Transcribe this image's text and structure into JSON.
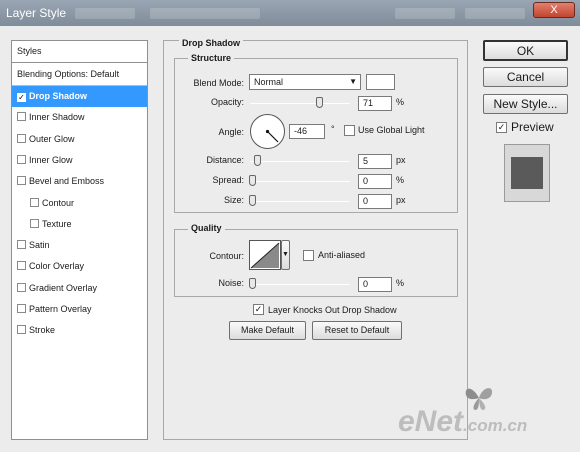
{
  "window": {
    "title": "Layer Style",
    "close_label": "X"
  },
  "styles_panel": {
    "header": "Styles",
    "blending_options": "Blending Options: Default",
    "items": [
      {
        "label": "Drop Shadow",
        "checked": true,
        "selected": true
      },
      {
        "label": "Inner Shadow",
        "checked": false
      },
      {
        "label": "Outer Glow",
        "checked": false
      },
      {
        "label": "Inner Glow",
        "checked": false
      },
      {
        "label": "Bevel and Emboss",
        "checked": false
      },
      {
        "label": "Contour",
        "checked": false,
        "indented": true
      },
      {
        "label": "Texture",
        "checked": false,
        "indented": true
      },
      {
        "label": "Satin",
        "checked": false
      },
      {
        "label": "Color Overlay",
        "checked": false
      },
      {
        "label": "Gradient Overlay",
        "checked": false
      },
      {
        "label": "Pattern Overlay",
        "checked": false
      },
      {
        "label": "Stroke",
        "checked": false
      }
    ]
  },
  "drop_shadow": {
    "title": "Drop Shadow",
    "structure": {
      "title": "Structure",
      "blend_mode_label": "Blend Mode:",
      "blend_mode_value": "Normal",
      "shadow_color": "#ffffff",
      "opacity_label": "Opacity:",
      "opacity_value": "71",
      "opacity_unit": "%",
      "angle_label": "Angle:",
      "angle_value": "-46",
      "angle_unit": "°",
      "use_global_light_label": "Use Global Light",
      "use_global_light_checked": false,
      "distance_label": "Distance:",
      "distance_value": "5",
      "distance_unit": "px",
      "spread_label": "Spread:",
      "spread_value": "0",
      "spread_unit": "%",
      "size_label": "Size:",
      "size_value": "0",
      "size_unit": "px"
    },
    "quality": {
      "title": "Quality",
      "contour_label": "Contour:",
      "anti_aliased_label": "Anti-aliased",
      "anti_aliased_checked": false,
      "noise_label": "Noise:",
      "noise_value": "0",
      "noise_unit": "%"
    },
    "knockout_label": "Layer Knocks Out Drop Shadow",
    "knockout_checked": true,
    "make_default_label": "Make Default",
    "reset_default_label": "Reset to Default"
  },
  "buttons": {
    "ok_label": "OK",
    "cancel_label": "Cancel",
    "new_style_label": "New Style...",
    "preview_label": "Preview",
    "preview_checked": true
  },
  "watermark": {
    "logo_main": "eNet",
    "logo_suffix": ".com.cn"
  }
}
